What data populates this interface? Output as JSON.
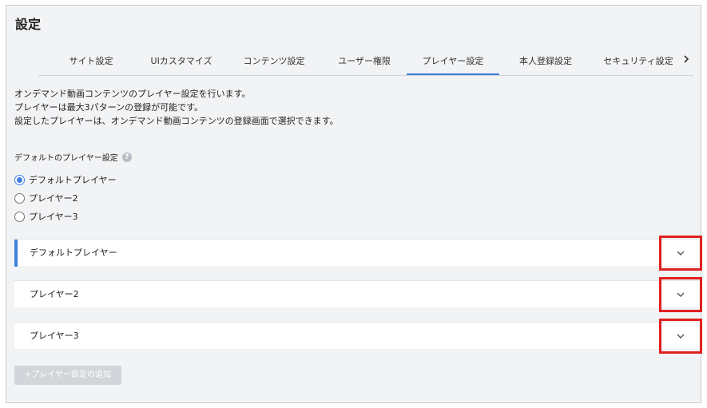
{
  "page": {
    "title": "設定"
  },
  "tabs": [
    {
      "label": "サイト設定"
    },
    {
      "label": "UIカスタマイズ"
    },
    {
      "label": "コンテンツ設定"
    },
    {
      "label": "ユーザー権限"
    },
    {
      "label": "プレイヤー設定",
      "active": true
    },
    {
      "label": "本人登録設定"
    },
    {
      "label": "セキュリティ設定"
    }
  ],
  "tabs_more_icon": "chevron-right-icon",
  "description": {
    "line1": "オンデマンド動画コンテンツのプレイヤー設定を行います。",
    "line2": "プレイヤーは最大3パターンの登録が可能です。",
    "line3": "設定したプレイヤーは、オンデマンド動画コンテンツの登録画面で選択できます。"
  },
  "default_player": {
    "label": "デフォルトのプレイヤー設定",
    "help_icon": "?",
    "options": [
      {
        "label": "デフォルトプレイヤー",
        "checked": true
      },
      {
        "label": "プレイヤー2",
        "checked": false
      },
      {
        "label": "プレイヤー3",
        "checked": false
      }
    ]
  },
  "accordions": [
    {
      "label": "デフォルトプレイヤー",
      "selected": true,
      "icon": "chevron-down-icon"
    },
    {
      "label": "プレイヤー2",
      "selected": false,
      "icon": "chevron-down-icon"
    },
    {
      "label": "プレイヤー3",
      "selected": false,
      "icon": "chevron-down-icon"
    }
  ],
  "add_button": {
    "label": "+プレイヤー設定の追加",
    "disabled": true
  },
  "colors": {
    "accent": "#3d7fe0",
    "highlight_box": "#e02020",
    "background": "#f2f3f5",
    "disabled_button": "#d2d5d9"
  }
}
